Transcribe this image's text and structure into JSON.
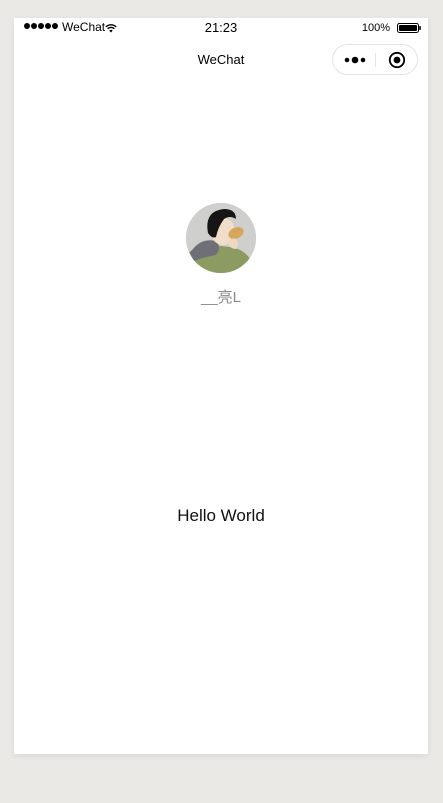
{
  "status_bar": {
    "carrier": "WeChat",
    "time": "21:23",
    "battery": "100%"
  },
  "nav": {
    "title": "WeChat"
  },
  "user": {
    "nickname": "__亮L"
  },
  "main": {
    "greeting": "Hello World"
  },
  "icons": [
    "signal-icon",
    "wifi-icon",
    "battery-icon",
    "more-icon",
    "close-icon",
    "avatar"
  ]
}
